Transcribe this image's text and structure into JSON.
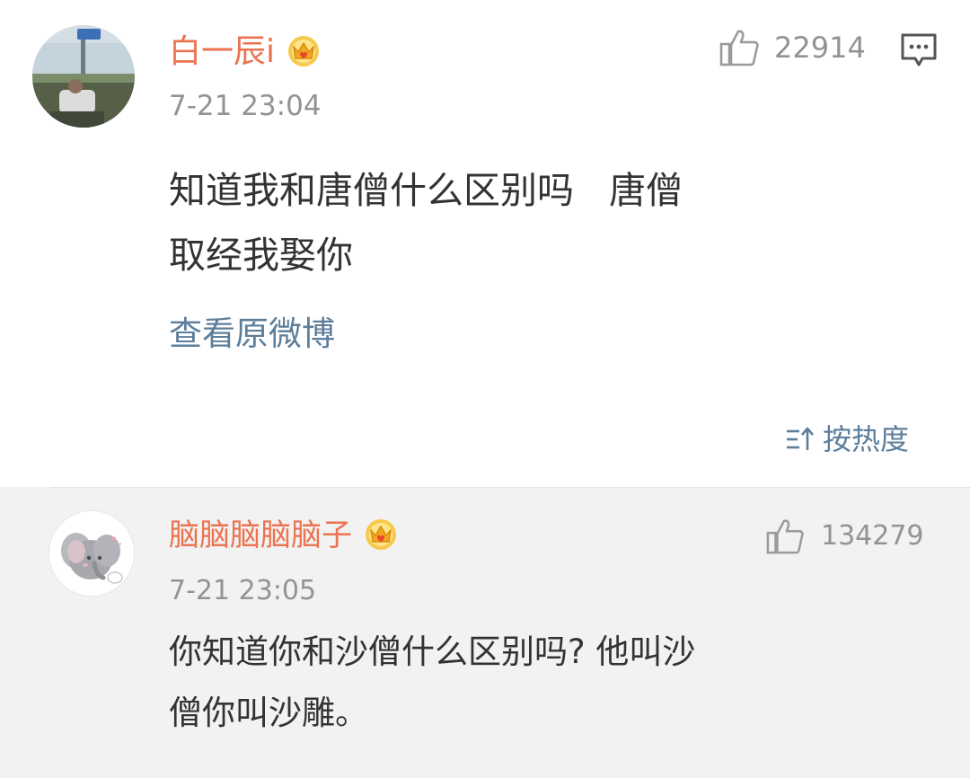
{
  "post": {
    "username": "白一辰i",
    "timestamp": "7-21 23:04",
    "like_count": "22914",
    "content": "知道我和唐僧什么区别吗   唐僧\n取经我娶你",
    "view_original_label": "查看原微博",
    "sort_label": "按热度",
    "icons": {
      "avatar": "user-avatar-photo",
      "badge": "crown-vip-badge",
      "like": "thumbs-up-icon",
      "comment": "comment-bubble-icon",
      "sort": "sort-icon"
    }
  },
  "comment": {
    "username": "脑脑脑脑脑子",
    "timestamp": "7-21 23:05",
    "like_count": "134279",
    "content": "你知道你和沙僧什么区别吗? 他叫沙\n僧你叫沙雕。",
    "icons": {
      "avatar": "elephant-avatar",
      "badge": "crown-vip-badge",
      "like": "thumbs-up-icon"
    }
  },
  "colors": {
    "username": "#eb7350",
    "link": "#5d7e9b",
    "meta": "#939393",
    "text": "#333333",
    "comment_background": "#f2f2f2"
  }
}
